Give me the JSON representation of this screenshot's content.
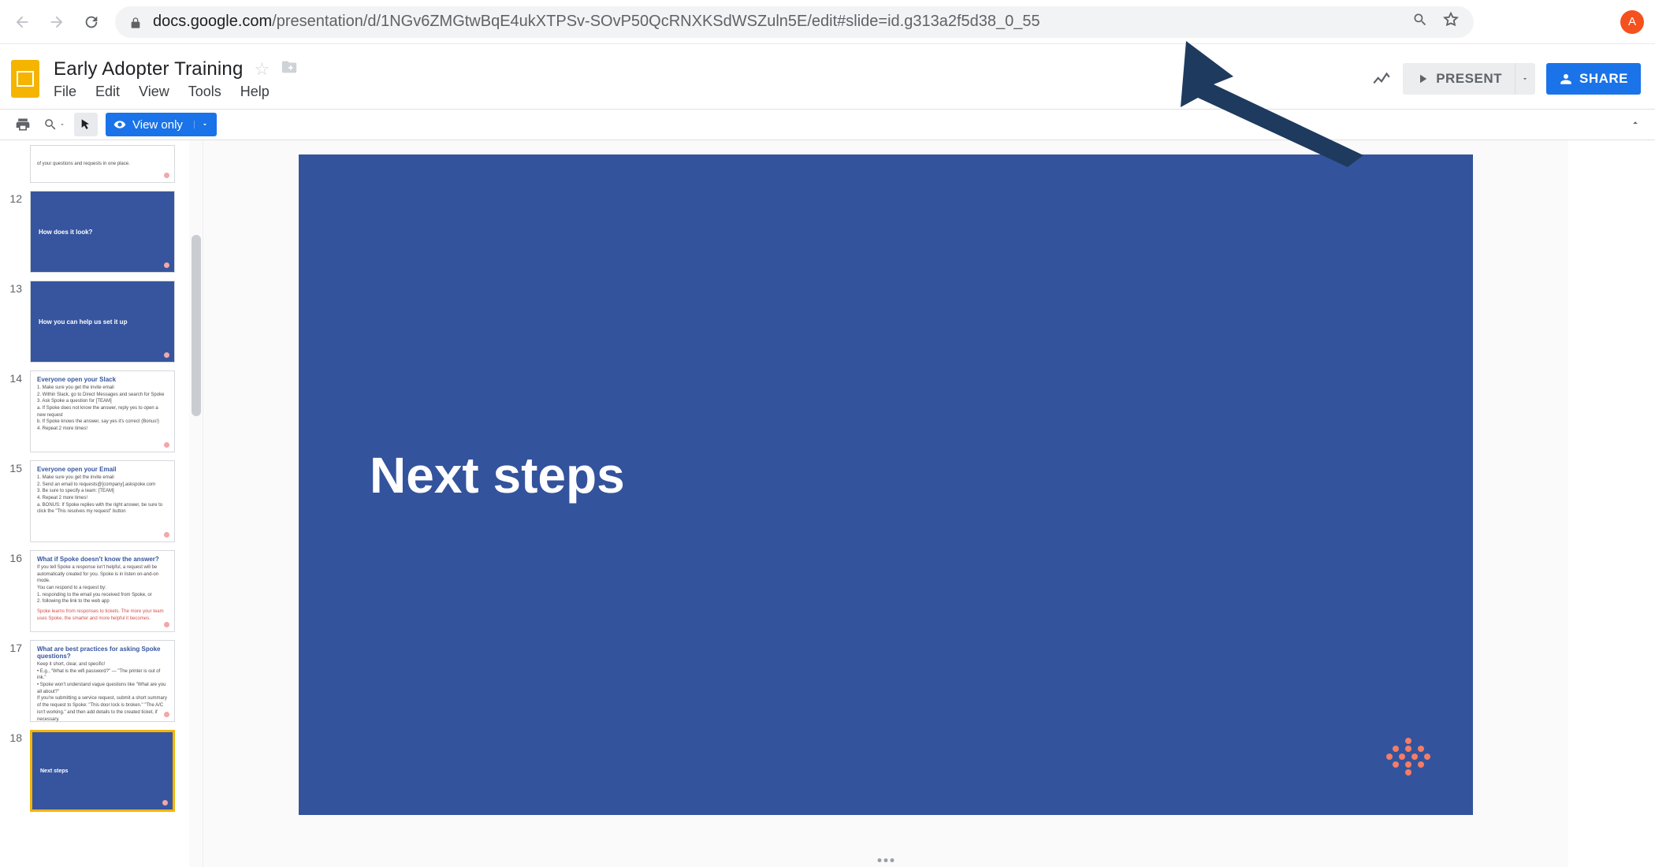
{
  "browser": {
    "url_domain": "docs.google.com",
    "url_path": "/presentation/d/1NGv6ZMGtwBqE4ukXTPSv-SOvP50QcRNXKSdWSZuln5E/edit#slide=id.g313a2f5d38_0_55",
    "avatar_initial": "A"
  },
  "header": {
    "doc_title": "Early Adopter Training",
    "menus": [
      "File",
      "Edit",
      "View",
      "Tools",
      "Help"
    ],
    "present_label": "PRESENT",
    "share_label": "SHARE"
  },
  "toolbar": {
    "view_only_label": "View only"
  },
  "filmstrip": {
    "first_visible_number": 12,
    "items": [
      {
        "num": "",
        "type": "white-top",
        "title": "",
        "body": "of your questions and requests in one place."
      },
      {
        "num": "12",
        "type": "blue",
        "title": "How does it look?"
      },
      {
        "num": "13",
        "type": "blue",
        "title": "How you can help us set it up"
      },
      {
        "num": "14",
        "type": "white",
        "title": "Everyone open your Slack",
        "body": "1. Make sure you get the invite email\n2. Within Slack, go to Direct Messages and search for Spoke\n3. Ask Spoke a question for [TEAM]\n   a. If Spoke does not know the answer, reply yes to open a new request\n   b. If Spoke knows the answer, say yes it's correct (Bonus!)\n4. Repeat 2 more times!"
      },
      {
        "num": "15",
        "type": "white",
        "title": "Everyone open your Email",
        "body": "1. Make sure you get the invite email\n2. Send an email to requests@[company].askspoke.com\n3. Be sure to specify a team: [TEAM]\n4. Repeat 2 more times!\n   a. BONUS: If Spoke replies with the right answer, be sure to click the \"This resolves my request\" button"
      },
      {
        "num": "16",
        "type": "white",
        "title": "What if Spoke doesn't know the answer?",
        "body": "If you tell Spoke a response isn't helpful, a request will be automatically created for you. Spoke is in listen on-and-on mode.\nYou can respond to a request by:\n1. responding to the email you received from Spoke, or\n2. following the link to the web app",
        "red": "Spoke learns from responses to tickets. The more your team uses Spoke, the smarter and more helpful it becomes."
      },
      {
        "num": "17",
        "type": "white",
        "title": "What are best practices for asking Spoke questions?",
        "body": "Keep it short, clear, and specific!\n• E.g., \"What is the wifi password?\" — \"The printer is out of ink.\"\n• Spoke won't understand vague questions like \"What are you all about?\"\nIf you're submitting a service request, submit a short summary of the request to Spoke: \"This door lock is broken.\" \"The A/C isn't working.\" and then add details to the created ticket, if necessary."
      },
      {
        "num": "18",
        "type": "blue",
        "title": "Next steps",
        "selected": true
      }
    ]
  },
  "slide": {
    "title": "Next steps"
  }
}
